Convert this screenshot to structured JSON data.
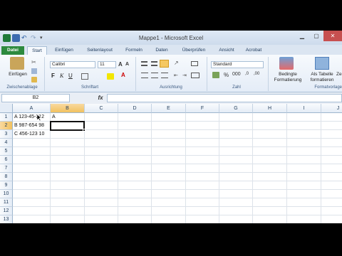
{
  "window": {
    "title": "Mappe1 - Microsoft Excel"
  },
  "tabs": [
    "Datei",
    "Start",
    "Einfügen",
    "Seitenlayout",
    "Formeln",
    "Daten",
    "Überprüfen",
    "Ansicht",
    "Acrobat"
  ],
  "ribbon": {
    "paste_label": "Einfügen",
    "font_name": "Calibri",
    "font_size": "11",
    "number_format": "Standard",
    "cond_format_label_1": "Bedingte",
    "cond_format_label_2": "Formatierung",
    "as_table_label_1": "Als Tabelle",
    "as_table_label_2": "formatieren",
    "cell_styles_label": "Ze",
    "groups": [
      "Zwischenablage",
      "Schriftart",
      "Ausrichtung",
      "Zahl",
      "Formatvorlage"
    ]
  },
  "formula_bar": {
    "name_box": "B2",
    "fx": "fx",
    "content": ""
  },
  "columns": [
    "A",
    "B",
    "C",
    "D",
    "E",
    "F",
    "G",
    "H",
    "I",
    "J"
  ],
  "rows": [
    "1",
    "2",
    "3",
    "4",
    "5",
    "6",
    "7",
    "8",
    "9",
    "10",
    "11",
    "12",
    "13"
  ],
  "cells": {
    "A1": "A 123-45-312",
    "B1": "A",
    "A2": "B 987-654 98",
    "A3": "C 456-123 10"
  },
  "active_cell": "B2",
  "colors": {
    "file_tab": "#2d8a3e",
    "selection_header": "#f1c15f",
    "accent": "#1e395b"
  }
}
